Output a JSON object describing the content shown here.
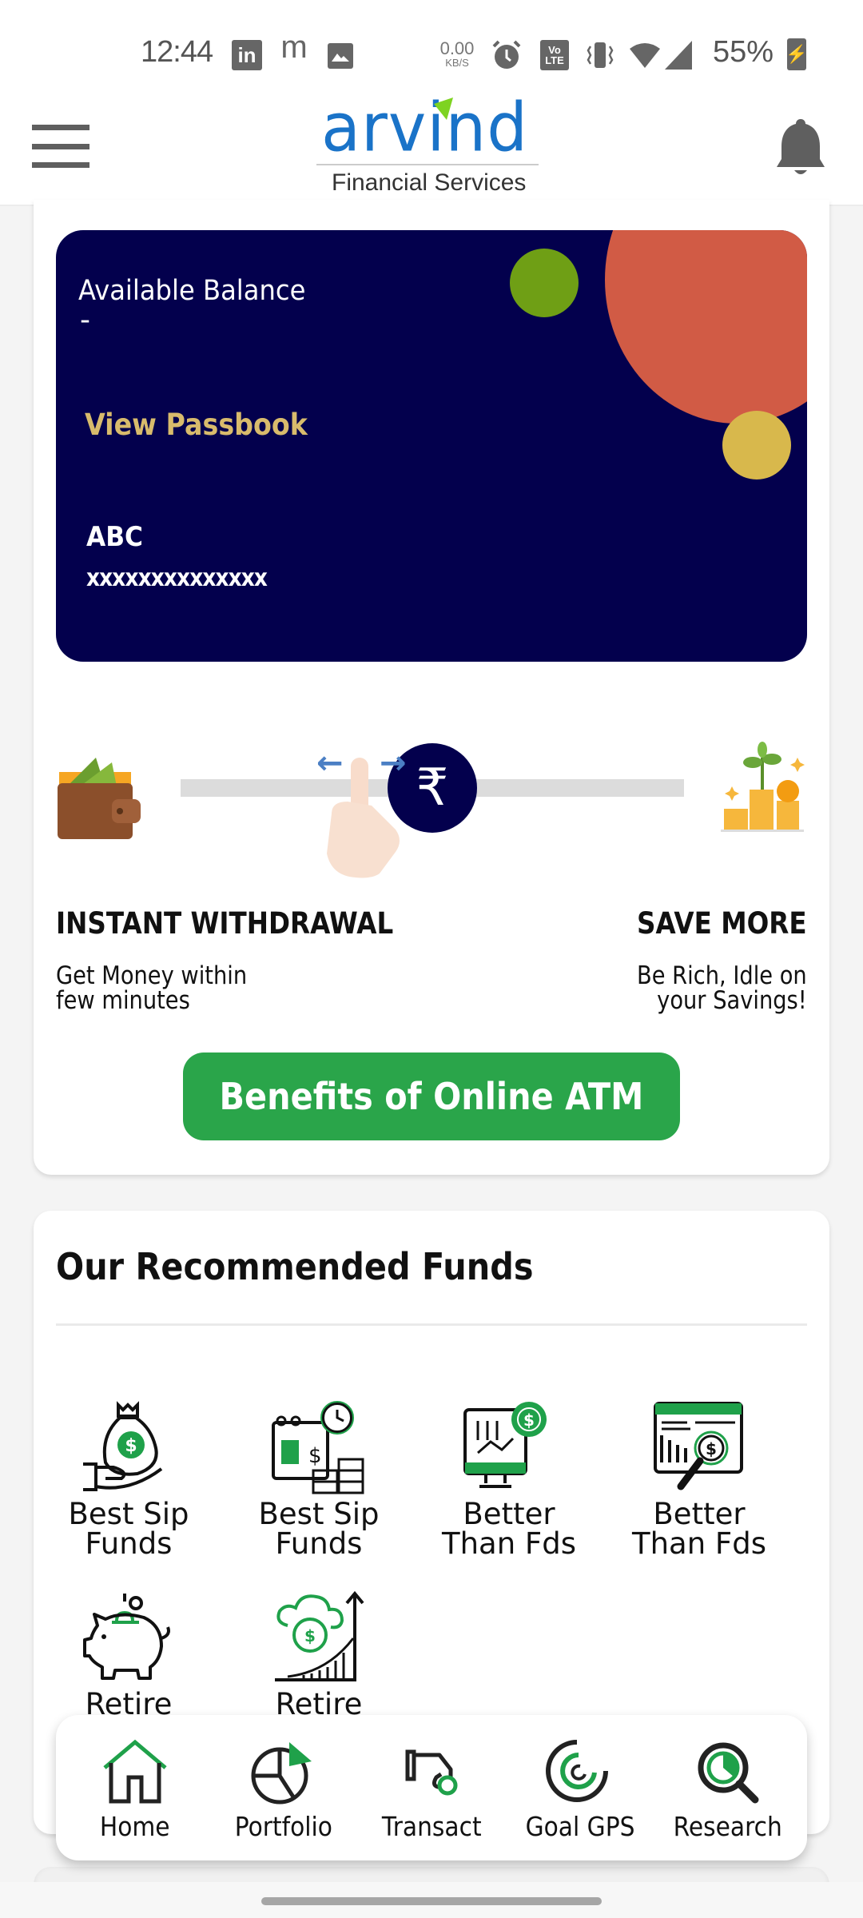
{
  "status_bar": {
    "time": "12:44",
    "notification_icons": [
      "linkedin-icon",
      "m-app-icon",
      "gallery-icon"
    ],
    "network_speed_value": "0.00",
    "network_speed_unit": "KB/S",
    "system_icons": [
      "alarm-icon",
      "volte-icon",
      "vibrate-icon",
      "wifi-icon",
      "cell-signal-icon"
    ],
    "volte_top": "Vo",
    "volte_bottom": "LTE",
    "battery_percent": "55%"
  },
  "header": {
    "logo_text": "arvind",
    "logo_subtitle": "Financial Services",
    "menu_icon": "hamburger-menu-icon",
    "notification_icon": "bell-icon"
  },
  "balance_card": {
    "label": "Available Balance",
    "value": "-",
    "passbook_link": "View Passbook",
    "account_name": "ABC",
    "account_number": "xxxxxxxxxxxxxx"
  },
  "slider": {
    "left_icon": "wallet-icon",
    "right_icon": "coins-plant-icon",
    "knob_symbol": "₹",
    "arrow_left": "←",
    "arrow_right": "→"
  },
  "features": {
    "left_title": "INSTANT WITHDRAWAL",
    "left_desc_line1": "Get Money within",
    "left_desc_line2": "few minutes",
    "right_title": "SAVE MORE",
    "right_desc_line1": "Be Rich, Idle on",
    "right_desc_line2": "your Savings!"
  },
  "cta_button": "Benefits of Online ATM",
  "recommended": {
    "title": "Our Recommended Funds",
    "funds": [
      {
        "line1": "Best Sip",
        "line2": "Funds",
        "icon": "money-bag-hand-icon"
      },
      {
        "line1": "Best Sip",
        "line2": "Funds",
        "icon": "calendar-coins-clock-icon"
      },
      {
        "line1": "Better",
        "line2": "Than Fds",
        "icon": "monitor-chart-dollar-icon"
      },
      {
        "line1": "Better",
        "line2": "Than Fds",
        "icon": "browser-magnifier-dollar-icon"
      },
      {
        "line1": "Retire",
        "line2": "",
        "icon": "piggy-bank-icon"
      },
      {
        "line1": "Retire",
        "line2": "",
        "icon": "cloud-dollar-growth-icon"
      }
    ]
  },
  "bottom_nav": {
    "items": [
      {
        "label": "Home",
        "icon": "home-icon",
        "active": true
      },
      {
        "label": "Portfolio",
        "icon": "pie-chart-icon",
        "active": false
      },
      {
        "label": "Transact",
        "icon": "hand-coin-icon",
        "active": false
      },
      {
        "label": "Goal GPS",
        "icon": "target-spiral-icon",
        "active": false
      },
      {
        "label": "Research",
        "icon": "magnifier-chart-icon",
        "active": false
      }
    ]
  },
  "colors": {
    "brand_blue": "#1a73c8",
    "brand_green": "#2aa54a",
    "card_navy": "#03004d",
    "passbook_gold": "#d8bb6c",
    "circle_orange": "#d15b45",
    "circle_green": "#6f9f15",
    "circle_yellow": "#d8b84c"
  }
}
